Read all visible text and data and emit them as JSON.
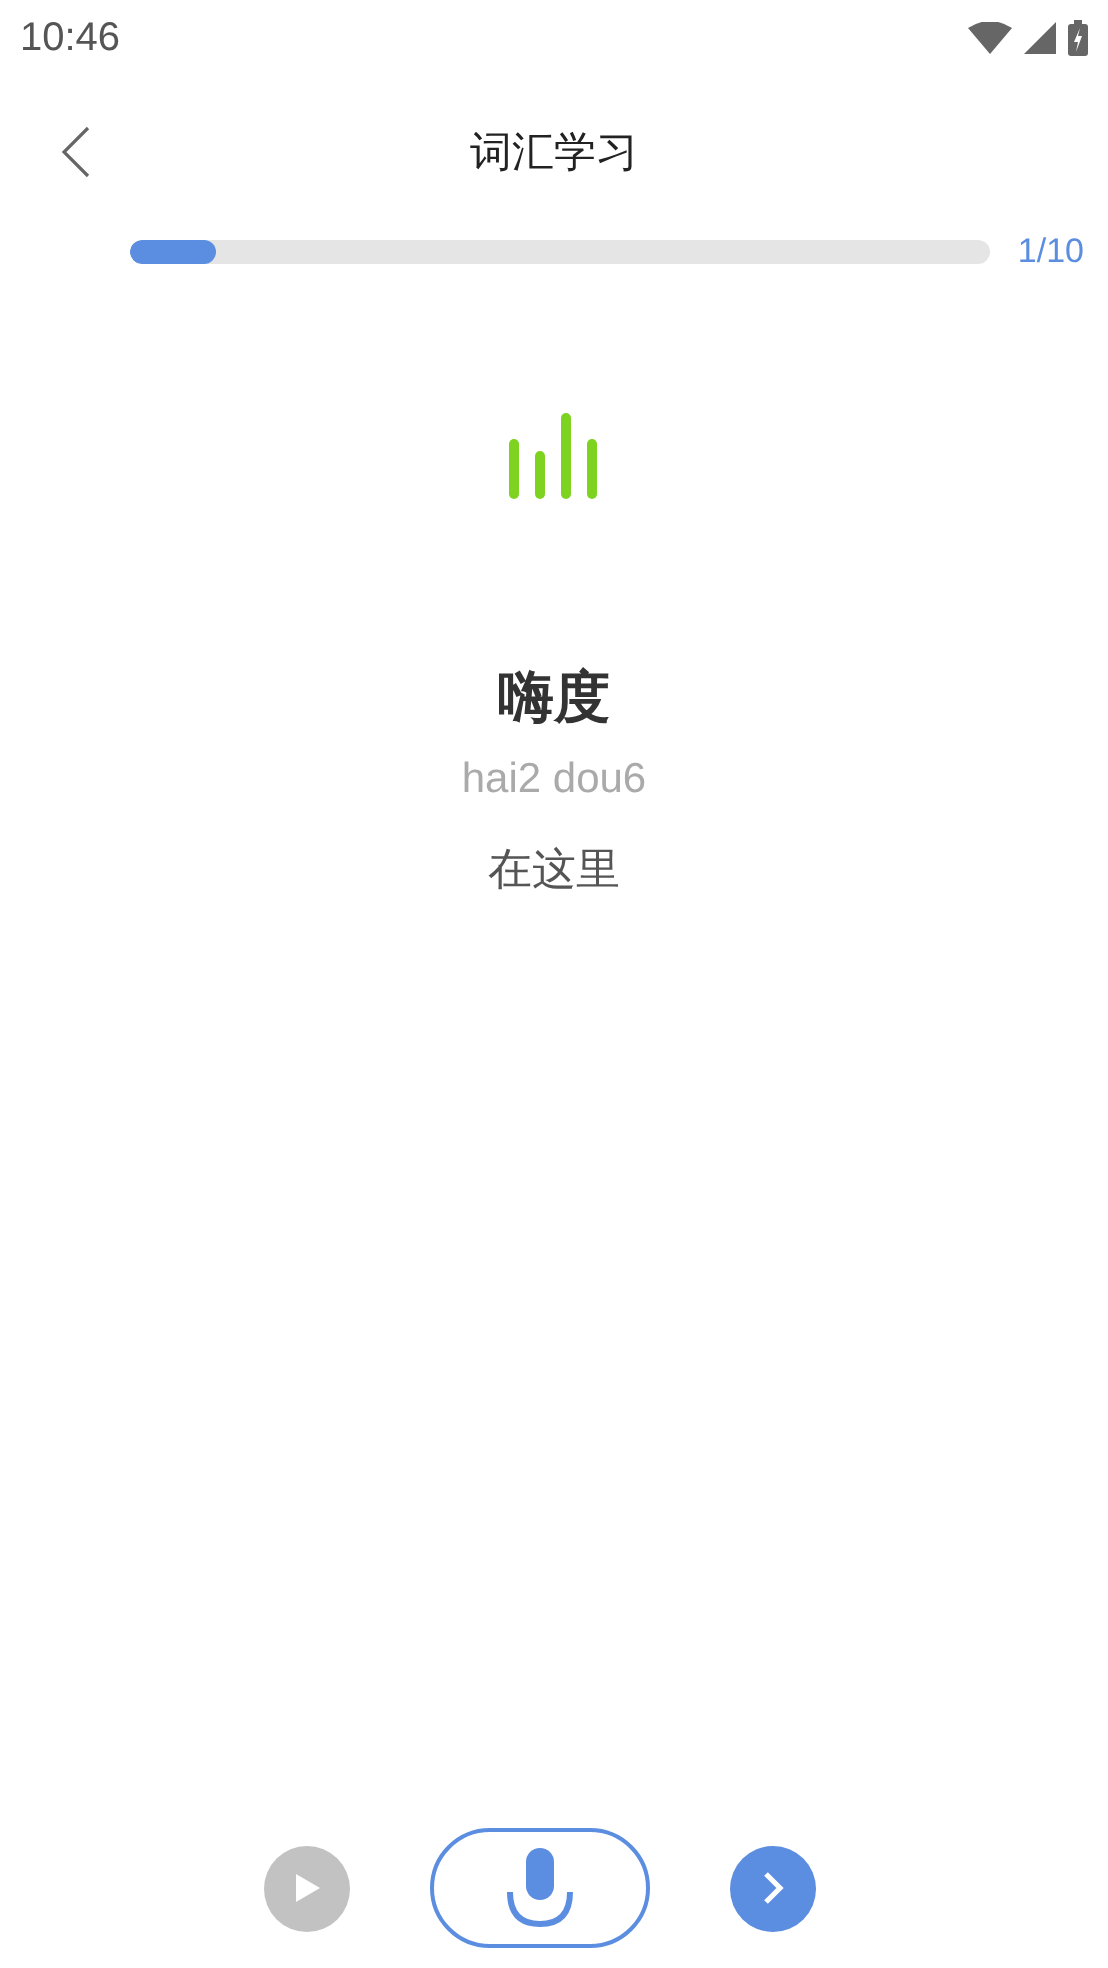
{
  "status_bar": {
    "time": "10:46"
  },
  "header": {
    "title": "词汇学习"
  },
  "progress": {
    "level": 0.1,
    "reading": "1/10"
  },
  "word": {
    "text": "嗨度",
    "pinyin": "hai2 dou6",
    "meaning": "在这里"
  },
  "controls": {
    "play_disabled": true
  }
}
